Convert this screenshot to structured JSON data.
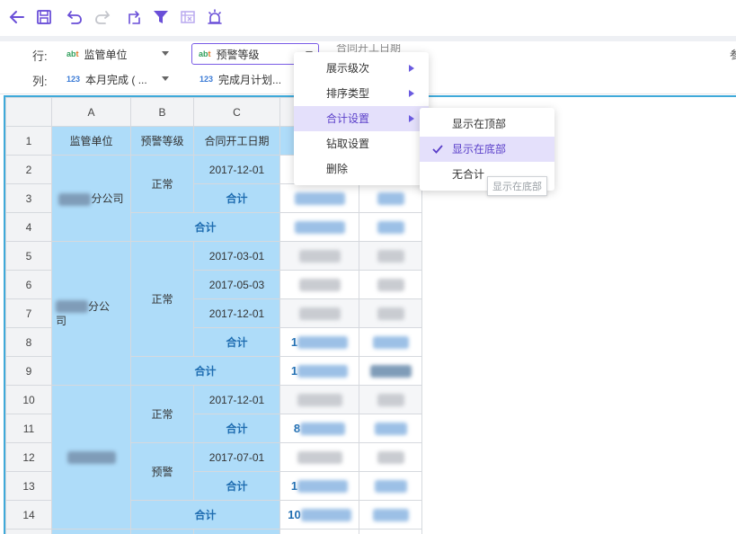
{
  "toolbar": {
    "icons": [
      "back-arrow-icon",
      "save-icon",
      "undo-icon",
      "redo-icon",
      "swap-icon",
      "filter-icon",
      "freeze-icon",
      "alert-icon"
    ],
    "accent_color": "#6a4fd8"
  },
  "pivot": {
    "row_label": "行:",
    "col_label": "列:",
    "row_fields": [
      {
        "type_prefix": "ab",
        "type_suffix": "t",
        "label": "监管单位"
      },
      {
        "type_prefix": "ab",
        "type_suffix": "t",
        "label": "预警等级"
      },
      {
        "type_prefix": "",
        "type_suffix": "",
        "label": "合同开工日期"
      }
    ],
    "col_fields": [
      {
        "type_prefix": "123",
        "label": "本月完成 ( ..."
      },
      {
        "type_prefix": "123",
        "label": "完成月计划..."
      }
    ],
    "right_truncated": "参"
  },
  "sheet": {
    "col_letters": [
      "A",
      "B",
      "C"
    ],
    "row_numbers": [
      "1",
      "2",
      "3",
      "4",
      "5",
      "6",
      "7",
      "8",
      "9",
      "10",
      "11",
      "12",
      "13",
      "14"
    ],
    "headers": [
      "监管单位",
      "预警等级",
      "合同开工日期"
    ],
    "units": [
      "分公司",
      "分公",
      "司"
    ],
    "grades": [
      "正常",
      "正常",
      "正常",
      "预警"
    ],
    "dates": [
      "2017-12-01",
      "2017-03-01",
      "2017-05-03",
      "2017-12-01",
      "2017-12-01",
      "2017-07-01"
    ],
    "total_label": "合计",
    "visible_digits": [
      "1",
      "1",
      "8",
      "1",
      "10"
    ]
  },
  "context_menu": {
    "items": [
      "展示级次",
      "排序类型",
      "合计设置",
      "钻取设置",
      "删除"
    ],
    "highlighted_index": 2
  },
  "submenu": {
    "items": [
      "显示在顶部",
      "显示在底部",
      "无合计"
    ],
    "selected_index": 1
  },
  "tooltip": "显示在底部"
}
